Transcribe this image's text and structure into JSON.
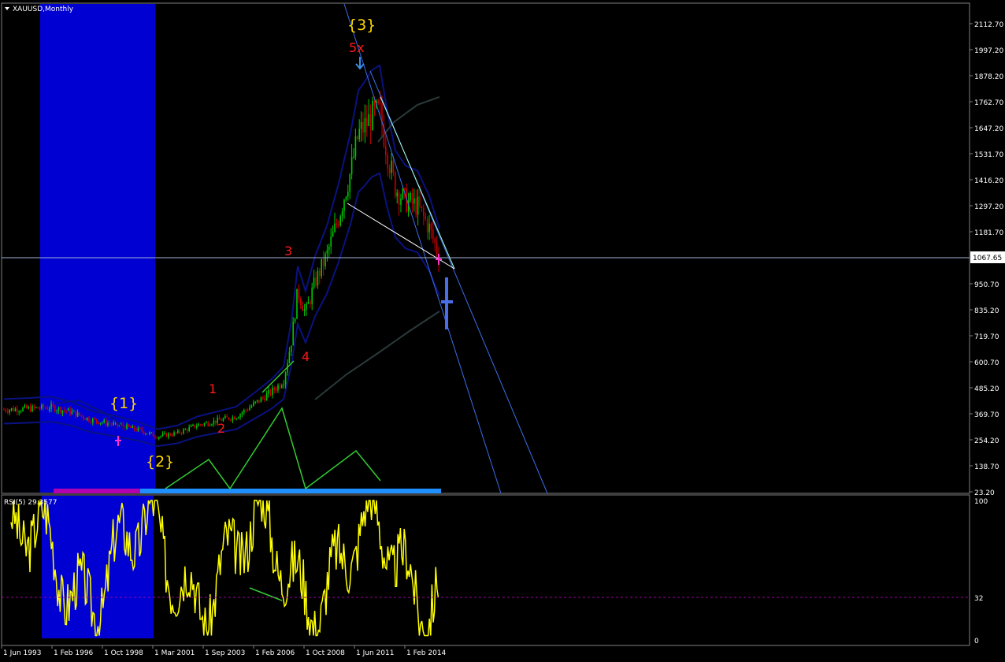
{
  "window": {
    "title": "XAUUSD,Monthly"
  },
  "current_price": "1067.65",
  "price_axis": [
    "2112.70",
    "1997.20",
    "1878.20",
    "1762.70",
    "1647.20",
    "1531.70",
    "1416.20",
    "1297.20",
    "1181.70",
    "950.70",
    "835.20",
    "719.70",
    "600.70",
    "485.20",
    "369.70",
    "254.20",
    "138.70",
    "23.20"
  ],
  "date_axis": [
    "1 Jun 1993",
    "1 Feb 1996",
    "1 Oct 1998",
    "1 Mar 2001",
    "1 Sep 2003",
    "1 Feb 2006",
    "1 Oct 2008",
    "1 Jun 2011",
    "1 Feb 2014"
  ],
  "rsi": {
    "title": "RSI(5) 29.3577",
    "ticks": [
      "100",
      "32",
      "0"
    ]
  },
  "wave_labels": [
    "{1}",
    "{2}",
    "{3}",
    "1",
    "2",
    "3",
    "4",
    "5x"
  ],
  "colors": {
    "background": "#000000",
    "up": "#00c800",
    "down": "#c80000",
    "highlight": "#0000d2",
    "rsi": "#ffff00",
    "envelope": "#0a1280",
    "wave_major": "#ffd700",
    "wave_minor": "#ff1a1a",
    "zigzag": "#33cc33"
  },
  "chart_data": [
    {
      "type": "candlestick",
      "title": "XAUUSD,Monthly",
      "x": [
        "1993-06",
        "1996-02",
        "1998-10",
        "2001-03",
        "2003-09",
        "2006-02",
        "2008-10",
        "2011-06",
        "2014-02",
        "2015-11"
      ],
      "close": [
        385,
        385,
        295,
        265,
        380,
        565,
        730,
        1530,
        1300,
        1068
      ],
      "peaks": [
        {
          "date": "2011-09",
          "value": 1920,
          "label": "5x"
        },
        {
          "date": "2008-03",
          "value": 1010,
          "label": "3"
        },
        {
          "date": "2008-10",
          "value": 690,
          "label": "4"
        },
        {
          "date": "1999-10",
          "value": 330,
          "label": "{1}"
        },
        {
          "date": "2001-03",
          "value": 255,
          "label": "{2}"
        }
      ],
      "ylim": [
        23.2,
        2170
      ],
      "last_value": 1067.65,
      "grid": false
    },
    {
      "type": "line",
      "title": "RSI(5) 29.3577",
      "series": [
        {
          "values": [
            45,
            55,
            60,
            40,
            50,
            48,
            30,
            85,
            25,
            20,
            15,
            70,
            50,
            40,
            30,
            80,
            20,
            95,
            45,
            90,
            70,
            35,
            30,
            40,
            20,
            75,
            60,
            30,
            25,
            55,
            40
          ]
        }
      ],
      "ylim": [
        0,
        100
      ],
      "level": 32
    }
  ]
}
